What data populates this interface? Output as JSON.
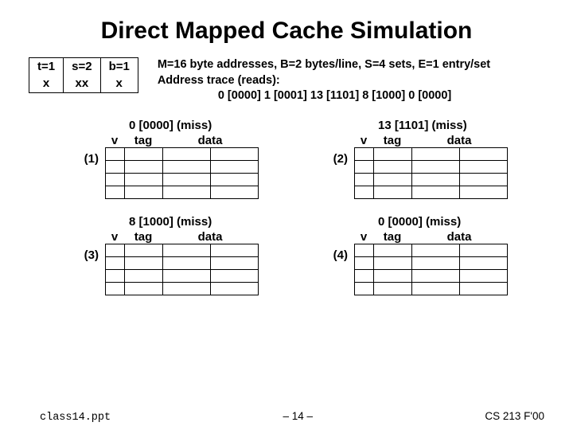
{
  "title": "Direct Mapped Cache Simulation",
  "bits": {
    "row1": {
      "t": "t=1",
      "s": "s=2",
      "b": "b=1"
    },
    "row2": {
      "t": "x",
      "s": "xx",
      "b": "x"
    }
  },
  "params": {
    "line1": "M=16 byte addresses, B=2 bytes/line, S=4 sets, E=1 entry/set",
    "line2": "Address trace (reads):",
    "line3": "0 [0000] 1 [0001] 13 [1101] 8 [1000] 0 [0000]"
  },
  "col": {
    "v": "v",
    "tag": "tag",
    "data": "data"
  },
  "states": [
    {
      "num": "(1)",
      "head": "0 [0000] (miss)"
    },
    {
      "num": "(2)",
      "head": "13 [1101] (miss)"
    },
    {
      "num": "(3)",
      "head": "8 [1000] (miss)"
    },
    {
      "num": "(4)",
      "head": "0 [0000] (miss)"
    }
  ],
  "footer": {
    "source": "class14.ppt",
    "page": "– 14 –",
    "course": "CS 213 F'00"
  }
}
